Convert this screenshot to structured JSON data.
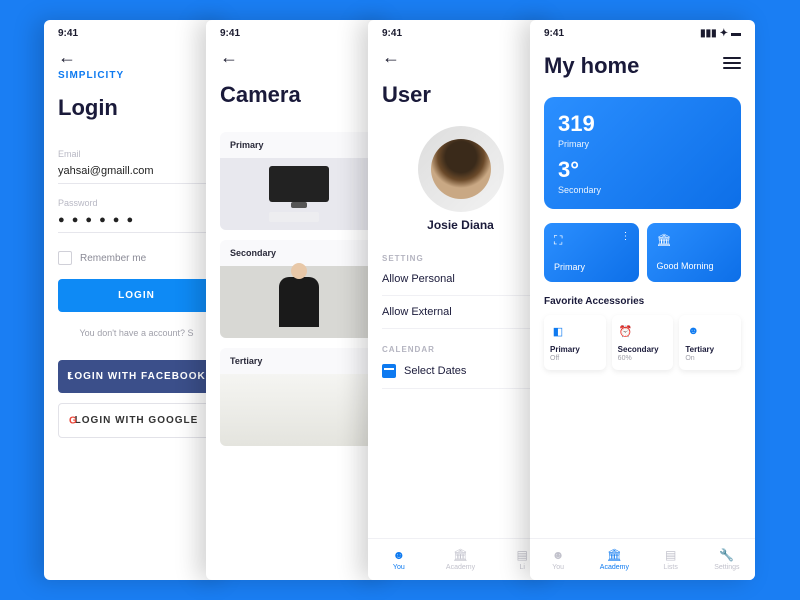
{
  "status_time": "9:41",
  "login": {
    "brand": "SIMPLICITY",
    "title": "Login",
    "email_label": "Email",
    "email_value": "yahsai@gmaill.com",
    "password_label": "Password",
    "password_value": "● ● ● ● ● ●",
    "remember_label": "Remember me",
    "login_btn": "LOGIN",
    "no_account": "You don't have a account? S",
    "facebook_btn": "LOGIN WITH FACEBOOK",
    "google_btn": "LOGIN WITH GOOGLE"
  },
  "camera": {
    "title": "Camera",
    "cards": [
      "Primary",
      "Secondary",
      "Tertiary"
    ]
  },
  "user": {
    "title": "User",
    "name": "Josie Diana",
    "setting_header": "SETTING",
    "allow_personal": "Allow Personal",
    "allow_external": "Allow External",
    "calendar_header": "CALENDAR",
    "select_dates": "Select Dates",
    "tabs": [
      "You",
      "Academy",
      "Li"
    ]
  },
  "home": {
    "title": "My home",
    "v1": "319",
    "v1_label": "Primary",
    "v2": "3°",
    "v2_label": "Secondary",
    "tile1": "Primary",
    "tile2": "Good Morning",
    "fav_header": "Favorite Accessories",
    "favs": [
      {
        "name": "Primary",
        "state": "Off"
      },
      {
        "name": "Secondary",
        "state": "60%"
      },
      {
        "name": "Tertiary",
        "state": "On"
      }
    ],
    "tabs": [
      "You",
      "Academy",
      "Lists",
      "Settings"
    ]
  }
}
